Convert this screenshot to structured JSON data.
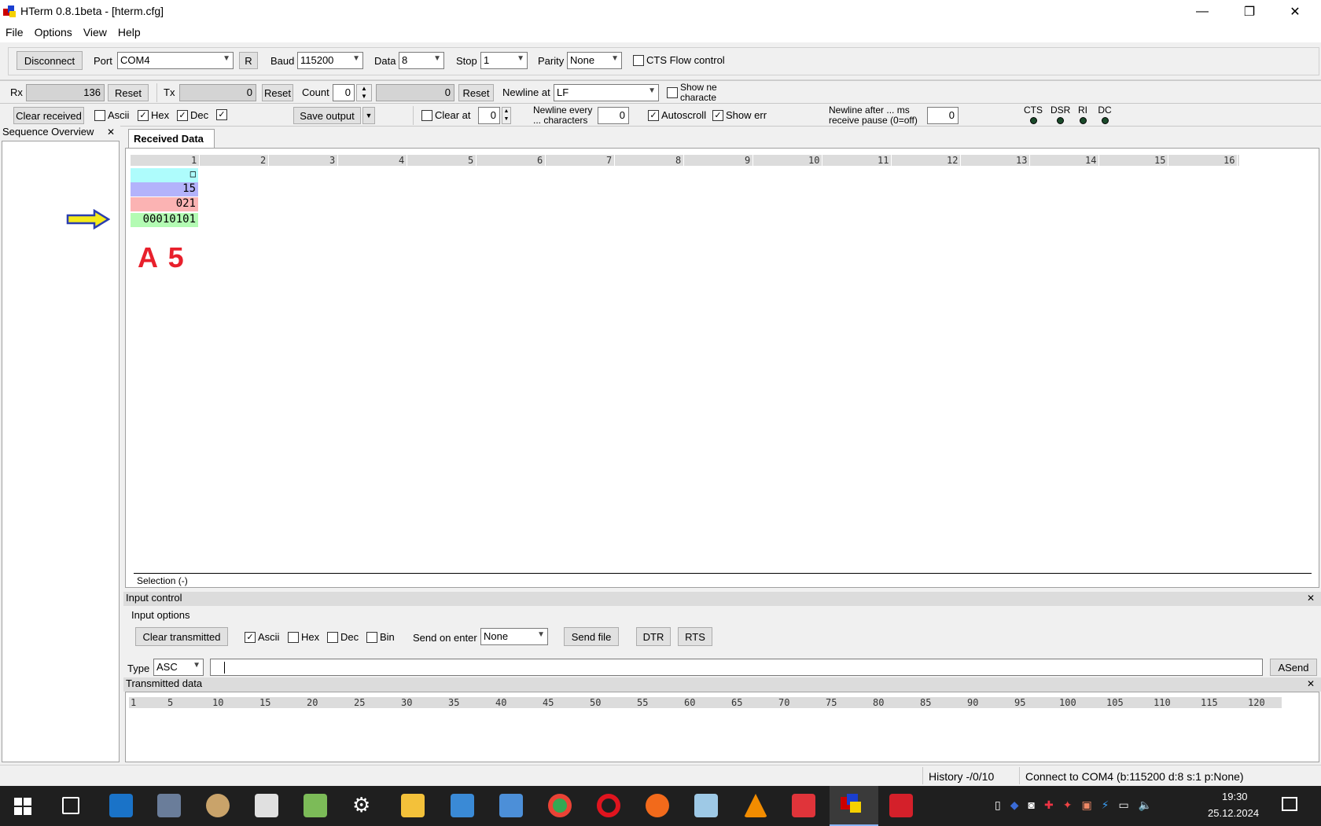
{
  "window": {
    "title": "HTerm 0.8.1beta - [hterm.cfg]"
  },
  "menu": [
    "File",
    "Options",
    "View",
    "Help"
  ],
  "conn": {
    "disconnect": "Disconnect",
    "port_label": "Port",
    "port": "COM4",
    "r": "R",
    "baud_label": "Baud",
    "baud": "115200",
    "data_label": "Data",
    "data": "8",
    "stop_label": "Stop",
    "stop": "1",
    "parity_label": "Parity",
    "parity": "None",
    "cts": "CTS Flow control"
  },
  "row2": {
    "rx": "Rx",
    "rx_val": "136",
    "reset": "Reset",
    "tx": "Tx",
    "tx_val": "0",
    "count": "Count",
    "count_val": "0",
    "count_field": "0",
    "newline_at": "Newline at",
    "newline_val": "LF",
    "show_newline": "Show ne\ncharacte"
  },
  "row3": {
    "clear_received": "Clear received",
    "ascii": "Ascii",
    "hex": "Hex",
    "dec": "Dec",
    "save_output": "Save output",
    "clear_at": "Clear at",
    "clear_at_val": "0",
    "newline_every": "Newline every\n... characters",
    "newline_every_val": "0",
    "autoscroll": "Autoscroll",
    "show_err": "Show err",
    "newline_after": "Newline after ... ms\nreceive pause (0=off)",
    "newline_after_val": "0",
    "leds": [
      "CTS",
      "DSR",
      "RI",
      "DC"
    ]
  },
  "sidebar": {
    "title": "Sequence Overview",
    "close": "✕"
  },
  "received": {
    "tab": "Received Data",
    "columns": [
      "1",
      "2",
      "3",
      "4",
      "5",
      "6",
      "7",
      "8",
      "9",
      "10",
      "11",
      "12",
      "13",
      "14",
      "15",
      "16"
    ],
    "rows": {
      "ascii": "□",
      "hex": "15",
      "dec": "021",
      "bin": "00010101"
    },
    "annotation": "A 5",
    "selection": "Selection (-)"
  },
  "input": {
    "title": "Input control",
    "options": "Input options",
    "clear_transmitted": "Clear transmitted",
    "ascii": "Ascii",
    "hex": "Hex",
    "dec": "Dec",
    "bin": "Bin",
    "send_on_enter": "Send on enter",
    "send_on_enter_val": "None",
    "send_file": "Send file",
    "dtr": "DTR",
    "rts": "RTS",
    "type": "Type",
    "type_val": "ASC",
    "asend": "ASend"
  },
  "transmitted": {
    "title": "Transmitted data",
    "ruler": [
      "1",
      "5",
      "10",
      "15",
      "20",
      "25",
      "30",
      "35",
      "40",
      "45",
      "50",
      "55",
      "60",
      "65",
      "70",
      "75",
      "80",
      "85",
      "90",
      "95",
      "100",
      "105",
      "110",
      "115",
      "120"
    ]
  },
  "status": {
    "history": "History -/0/10",
    "connect": "Connect to COM4 (b:115200 d:8 s:1 p:None)"
  },
  "clock": {
    "time": "19:30",
    "date": "25.12.2024"
  },
  "colors": {
    "ascii": "#aefcfc",
    "hex": "#b3b3fb",
    "dec": "#fbb3b3",
    "bin": "#b3fbb3",
    "annotation": "#e8202c",
    "arrow": "#f5ea1a"
  }
}
